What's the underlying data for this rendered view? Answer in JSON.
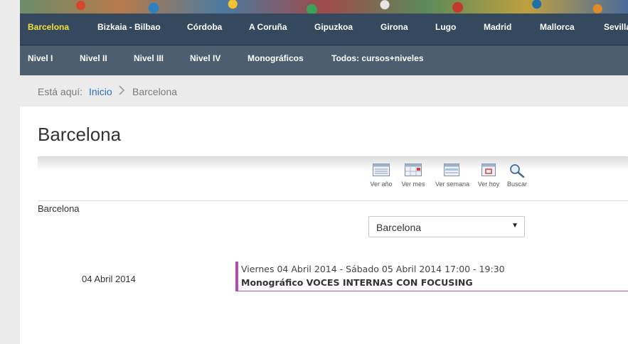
{
  "nav": {
    "cities": [
      "Barcelona",
      "Bizkaia - Bilbao",
      "Córdoba",
      "A Coruña",
      "Gipuzkoa",
      "Girona",
      "Lugo",
      "Madrid",
      "Mallorca",
      "Sevilla"
    ],
    "active_city": "Barcelona",
    "levels": [
      "Nivel I",
      "Nivel II",
      "Nivel III",
      "Nivel IV",
      "Monográficos",
      "Todos: cursos+niveles"
    ]
  },
  "breadcrumb": {
    "prefix": "Está aquí:",
    "home": "Inicio",
    "current": "Barcelona"
  },
  "page": {
    "title": "Barcelona"
  },
  "toolbar": {
    "year": "Ver año",
    "month": "Ver mes",
    "week": "Ver semana",
    "today": "Ver hoy",
    "search": "Buscar"
  },
  "filter": {
    "category_label": "Barcelona",
    "selected": "Barcelona"
  },
  "events": [
    {
      "date": "04 Abril 2014",
      "when": "Viernes 04 Abril 2014 - Sábado 05 Abril 2014 17:00 - 19:30",
      "title": "Monográfico VOCES INTERNAS CON FOCUSING"
    }
  ],
  "colors": {
    "nav_bg": "#34495e",
    "subnav_bg": "#4c5e70",
    "active": "#f1e23a",
    "link": "#2a6ebb",
    "event_accent": "#b54bb8"
  }
}
